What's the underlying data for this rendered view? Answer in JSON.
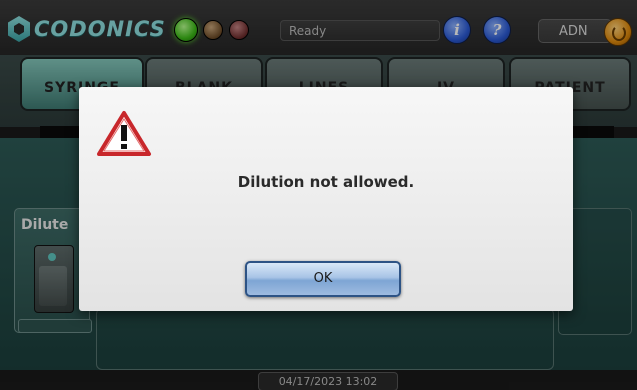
{
  "brand": {
    "logo_text": "CODONICS"
  },
  "header": {
    "status_text": "Ready",
    "user": "ADN",
    "indicators": [
      "green-led",
      "amber-led",
      "red-led"
    ]
  },
  "tabs": [
    {
      "label": "SYRINGE",
      "active": true
    },
    {
      "label": "BLANK",
      "active": false
    },
    {
      "label": "LINES",
      "active": false
    },
    {
      "label": "IV",
      "active": false
    },
    {
      "label": "PATIENT",
      "active": false
    }
  ],
  "main": {
    "dilute_label": "Dilute",
    "datetime": "04/17/2023 13:02"
  },
  "dialog": {
    "icon": "warning-icon",
    "message": "Dilution not allowed.",
    "ok_label": "OK"
  },
  "colors": {
    "accent_teal": "#8fe0df",
    "active_tab": "#84c7bb",
    "ok_button": "#a8c4e6",
    "warning_red": "#c8272b"
  }
}
